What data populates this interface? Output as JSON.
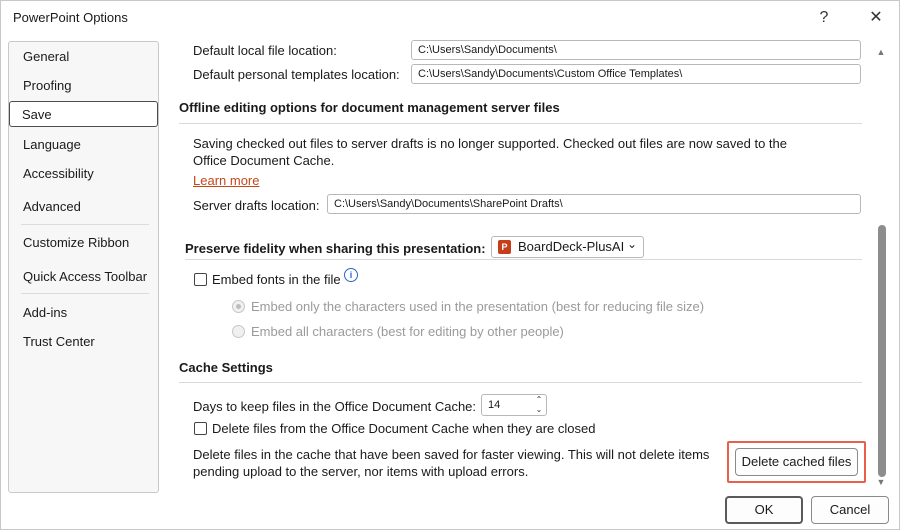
{
  "window": {
    "title": "PowerPoint Options",
    "help_glyph": "?",
    "close_glyph": "✕"
  },
  "nav": {
    "items": [
      "General",
      "Proofing",
      "Save",
      "Language",
      "Accessibility",
      "Advanced",
      "Customize Ribbon",
      "Quick Access Toolbar",
      "Add-ins",
      "Trust Center"
    ],
    "selected": "Save"
  },
  "locations": {
    "default_local_label": "Default local file location:",
    "default_local_value": "C:\\Users\\Sandy\\Documents\\",
    "templates_label": "Default personal templates location:",
    "templates_value": "C:\\Users\\Sandy\\Documents\\Custom Office Templates\\"
  },
  "offline": {
    "title": "Offline editing options for document management server files",
    "description": "Saving checked out files to server drafts is no longer supported. Checked out files are now saved to the Office Document Cache.",
    "learn_more": "Learn more",
    "drafts_label": "Server drafts location:",
    "drafts_value": "C:\\Users\\Sandy\\Documents\\SharePoint Drafts\\"
  },
  "fidelity": {
    "title": "Preserve fidelity when sharing this presentation:",
    "presentation": "BoardDeck-PlusAI",
    "ppt_icon_glyph": "P",
    "dropdown_glyph": "⌄",
    "info_glyph": "i",
    "embed_fonts": "Embed fonts in the file",
    "embed_fonts_checked": false,
    "option_only_used": "Embed only the characters used in the presentation (best for reducing file size)",
    "option_all": "Embed all characters (best for editing by other people)",
    "selected_option": "only_used"
  },
  "cache": {
    "title": "Cache Settings",
    "days_label": "Days to keep files in the Office Document Cache:",
    "days_value": "14",
    "spinner_glyphs": "⌃⌄",
    "delete_on_close": "Delete files from the Office Document Cache when they are closed",
    "delete_on_close_checked": false,
    "delete_description": "Delete files in the cache that have been saved for faster viewing. This will not delete items pending upload to the server, nor items with upload errors.",
    "delete_button": "Delete cached files"
  },
  "footer": {
    "ok": "OK",
    "cancel": "Cancel"
  },
  "scroll": {
    "up_glyph": "▲",
    "down_glyph": "▼"
  },
  "colors": {
    "highlight": "#e8604c",
    "link": "#c3491a",
    "ppt_brand": "#c43e1c"
  }
}
